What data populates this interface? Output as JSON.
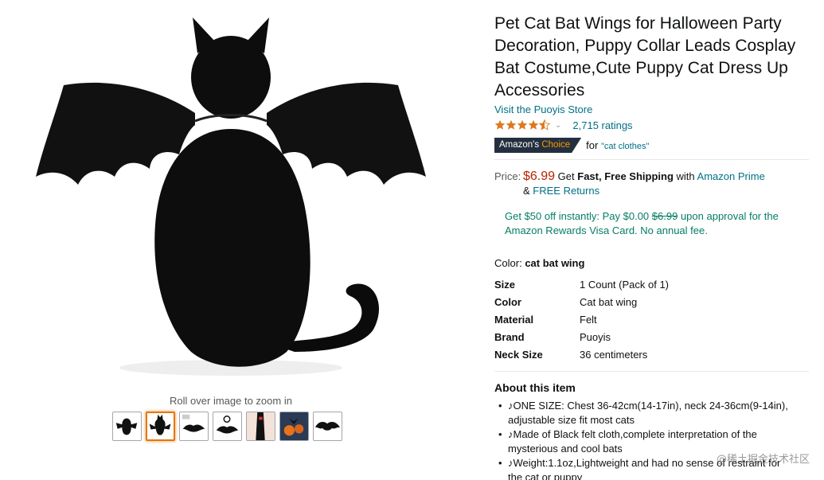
{
  "gallery": {
    "zoom_hint": "Roll over image to zoom in",
    "main_image_alt": "black cat wearing bat wings",
    "thumbnails": [
      "thumb-cat-wings-front",
      "thumb-cat-wings-back",
      "thumb-wings-diagram",
      "thumb-product-set",
      "thumb-model-collar",
      "thumb-halloween-scene",
      "thumb-bat-wing"
    ],
    "selected_index": 1
  },
  "product": {
    "title": "Pet Cat Bat Wings for Halloween Party Decoration, Puppy Collar Leads Cosplay Bat Costume,Cute Puppy Cat Dress Up Accessories",
    "store_link": "Visit the Puoyis Store",
    "rating_stars": 4.5,
    "ratings_count": "2,715 ratings",
    "badge": {
      "prefix": "Amazon's",
      "highlight": "Choice",
      "for_text": "for",
      "keyword": "\"cat clothes\""
    }
  },
  "price": {
    "label": "Price:",
    "value": "$6.99",
    "get": "Get",
    "shipping": "Fast, Free Shipping",
    "with": "with",
    "prime": "Amazon Prime",
    "amp": "&",
    "returns": "FREE Returns"
  },
  "promo": {
    "part1": "Get $50 off instantly: Pay $0.00",
    "strike": "$6.99",
    "part2": "upon approval for the Amazon Rewards Visa Card. No annual fee."
  },
  "color": {
    "label": "Color:",
    "value": "cat bat wing"
  },
  "specs": [
    {
      "key": "Size",
      "value": "1 Count (Pack of 1)"
    },
    {
      "key": "Color",
      "value": "Cat bat wing"
    },
    {
      "key": "Material",
      "value": "Felt"
    },
    {
      "key": "Brand",
      "value": "Puoyis"
    },
    {
      "key": "Neck Size",
      "value": "36 centimeters"
    }
  ],
  "about": {
    "title": "About this item",
    "bullets": [
      "♪ONE SIZE: Chest 36-42cm(14-17in), neck 24-36cm(9-14in), adjustable size fit most cats",
      "♪Made of Black felt cloth,complete interpretation of the mysterious and cool bats",
      "♪Weight:1.1oz,Lightweight and had no sense of restraint for the cat or puppy"
    ]
  },
  "watermark": "@稀土掘金技术社区",
  "colors": {
    "link": "#007185",
    "price": "#b12704",
    "promo": "#067d62",
    "star": "#de7921",
    "badge_bg": "#232f3e",
    "badge_orange": "#ff9900"
  }
}
